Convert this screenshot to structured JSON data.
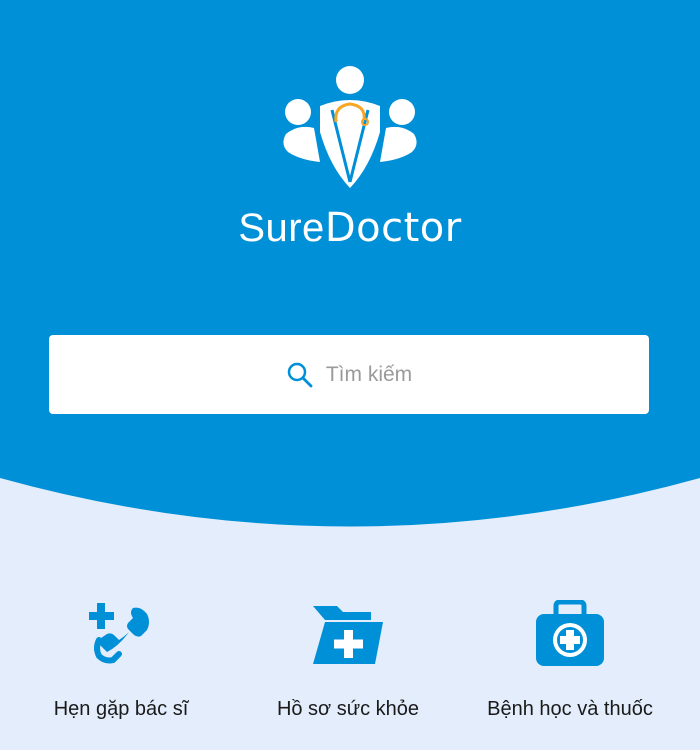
{
  "colors": {
    "primary": "#0090d8",
    "background": "#e3edfb",
    "accent": "#f5a623"
  },
  "brand": {
    "part1": "Sure",
    "part2": "Doctor"
  },
  "search": {
    "placeholder": "Tìm kiếm",
    "icon": "search-icon"
  },
  "actions": [
    {
      "label": "Hẹn gặp bác sĩ",
      "icon": "phone-plus-icon"
    },
    {
      "label": "Hồ sơ sức khỏe",
      "icon": "folder-plus-icon"
    },
    {
      "label": "Bệnh học và thuốc",
      "icon": "medical-kit-icon"
    }
  ]
}
